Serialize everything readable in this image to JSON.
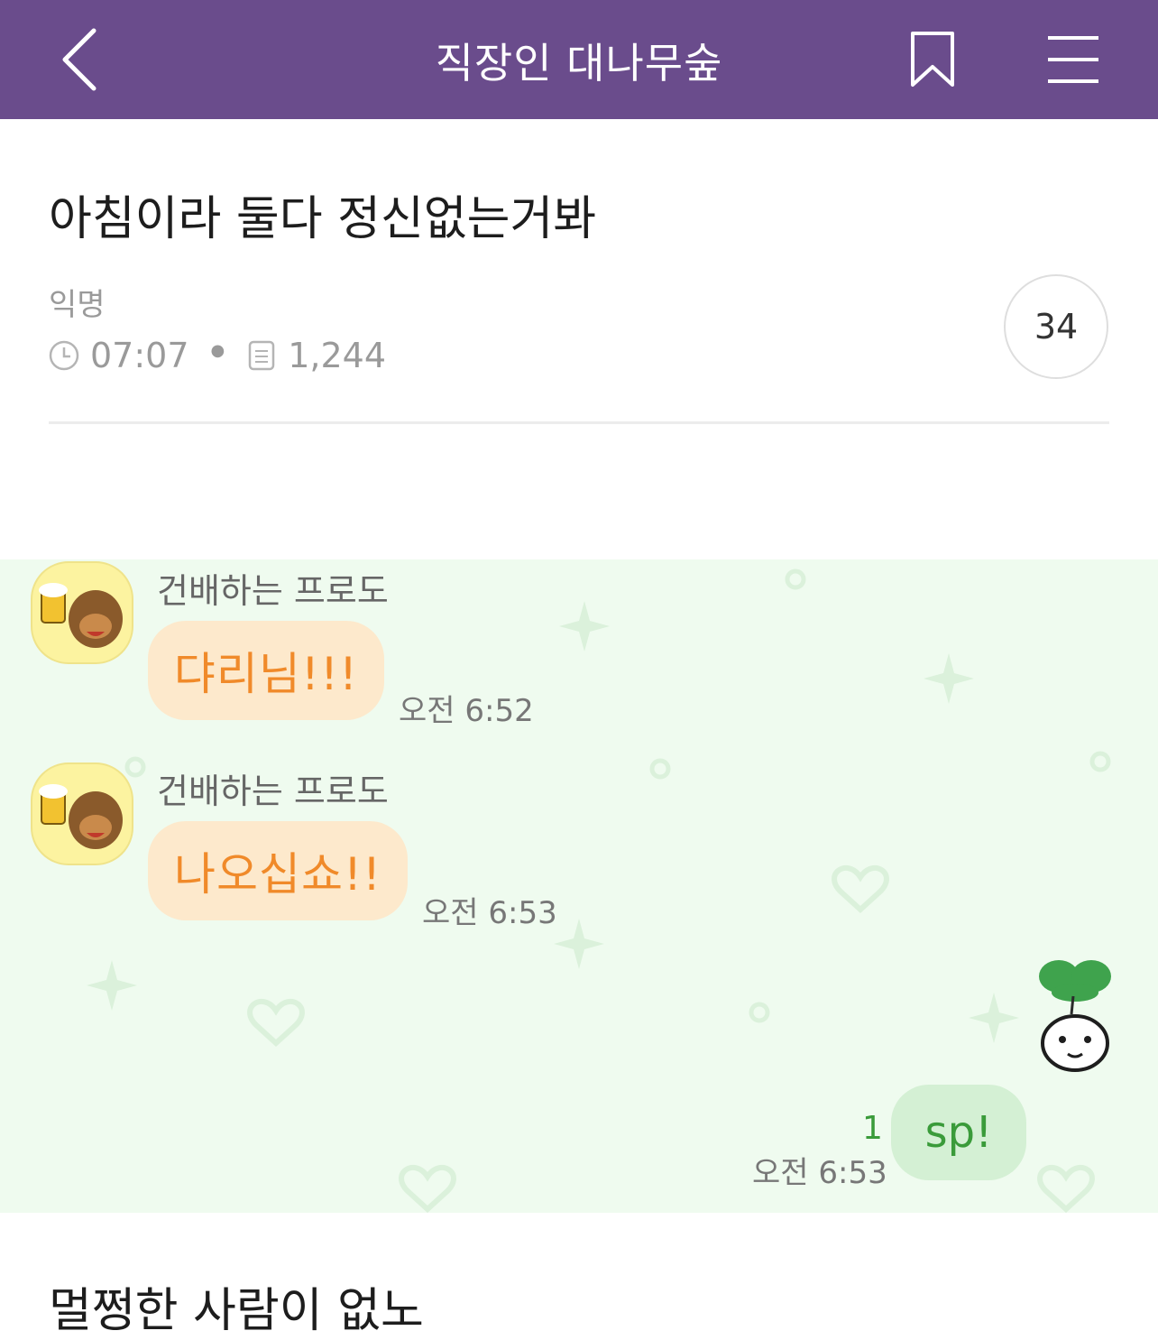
{
  "header": {
    "title": "직장인 대나무숲",
    "back_icon": "chevron-left-icon",
    "bookmark_icon": "bookmark-icon",
    "menu_icon": "hamburger-menu-icon",
    "background_color": "#6a4c8c"
  },
  "post": {
    "title": "아침이라 둘다 정신없는거봐",
    "author": "익명",
    "time": "07:07",
    "views": "1,244",
    "comment_count": "34",
    "body": "멀쩡한 사람이 없노"
  },
  "chat_image": {
    "messages": [
      {
        "sender": "건배하는 프로도",
        "text": "댜리님!!!",
        "time": "오전 6:52"
      },
      {
        "sender": "건배하는 프로도",
        "text": "나오십쇼!!",
        "time": "오전 6:53"
      },
      {
        "text": "sp!",
        "time": "오전 6:53",
        "unread": "1",
        "outgoing": true
      }
    ]
  }
}
